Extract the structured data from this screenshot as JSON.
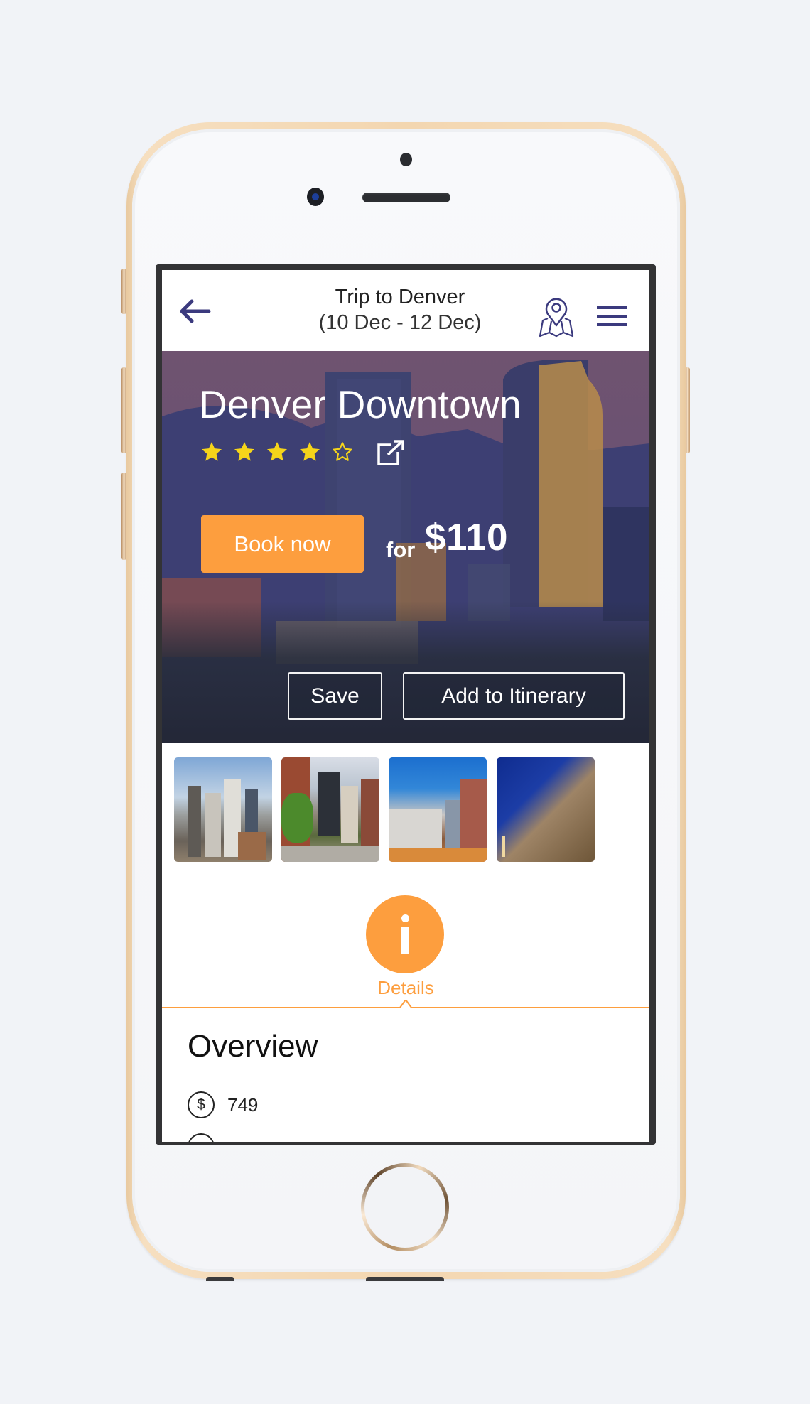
{
  "header": {
    "title": "Trip to Denver",
    "dates": "(10 Dec - 12 Dec)",
    "back_icon": "arrow-left-icon",
    "map_icon": "map-pin-icon",
    "menu_icon": "hamburger-menu-icon"
  },
  "hero": {
    "name": "Denver Downtown",
    "rating": 4,
    "rating_max": 5,
    "external_link_icon": "external-link-icon",
    "book_label": "Book now",
    "price_prefix": "for",
    "price": "$110",
    "save_label": "Save",
    "itinerary_label": "Add to Itinerary"
  },
  "gallery": {
    "thumbnails": [
      {
        "subject": "downtown skyline"
      },
      {
        "subject": "street with brick buildings"
      },
      {
        "subject": "hotel at dusk"
      },
      {
        "subject": "modern building at night"
      }
    ]
  },
  "tabs": {
    "active": {
      "label": "Details",
      "icon": "info-icon"
    }
  },
  "overview": {
    "title": "Overview",
    "rows": [
      {
        "icon": "$",
        "icon_name": "dollar-icon",
        "value": "749"
      },
      {
        "icon": "",
        "icon_name": "circle-icon",
        "value": ""
      }
    ]
  },
  "colors": {
    "accent": "#fd9e3e",
    "nav_icon": "#3b3a7e",
    "star": "#f5d41a",
    "phone_gold": "#f3d6b0"
  }
}
